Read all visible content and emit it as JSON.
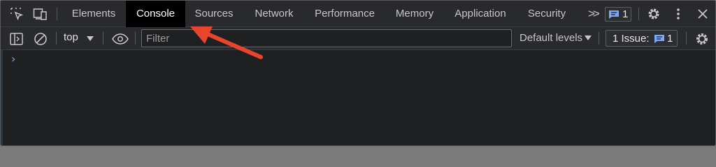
{
  "tabbar": {
    "tabs": [
      {
        "label": "Elements"
      },
      {
        "label": "Console"
      },
      {
        "label": "Sources"
      },
      {
        "label": "Network"
      },
      {
        "label": "Performance"
      },
      {
        "label": "Memory"
      },
      {
        "label": "Application"
      },
      {
        "label": "Security"
      }
    ],
    "active_tab": "Console",
    "overflow_glyph": ">>",
    "message_count": "1"
  },
  "toolbar": {
    "context": "top",
    "filter_placeholder": "Filter",
    "filter_value": "",
    "default_levels": "Default levels",
    "issues_label": "1 Issue:",
    "issues_count": "1"
  },
  "console": {
    "prompt": "›"
  },
  "colors": {
    "background": "#1f2022",
    "toolbar": "#292a2d",
    "active_tab": "#000000",
    "issue_icon": "#7ca8f5",
    "prompt": "#7fa9e8",
    "annotation_arrow": "#e8452c"
  }
}
